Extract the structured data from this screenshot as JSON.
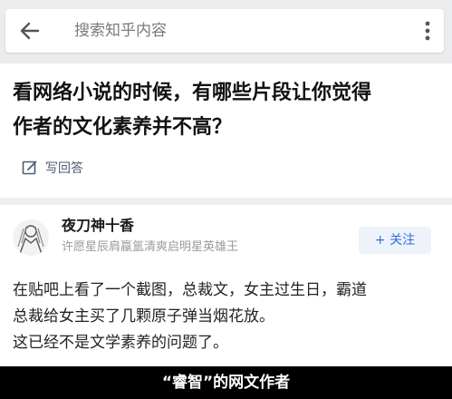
{
  "search": {
    "placeholder": "搜索知乎内容"
  },
  "question": {
    "title_line1": "看网络小说的时候，有哪些片段让你觉得",
    "title_line2": "作者的文化素养并不高？",
    "write_answer_label": "写回答"
  },
  "answer": {
    "author_name": "夜刀神十香",
    "author_bio": "许愿星辰肩蠃氲清爽启明星英雄王",
    "follow_label": "+ 关注",
    "paragraphs": [
      "在贴吧上看了一个截图，总裁文，女主过生日，霸道",
      "总裁给女主买了几颗原子弹当烟花放。",
      "这已经不是文学素养的问题了。"
    ]
  },
  "caption": "“睿智”的网文作者",
  "colors": {
    "accent": "#2f6fd8",
    "muted": "#9a9a9a",
    "caption_bg": "#000000"
  },
  "icons": {
    "back": "back-arrow-icon",
    "more": "more-vertical-icon",
    "edit": "edit-icon"
  }
}
